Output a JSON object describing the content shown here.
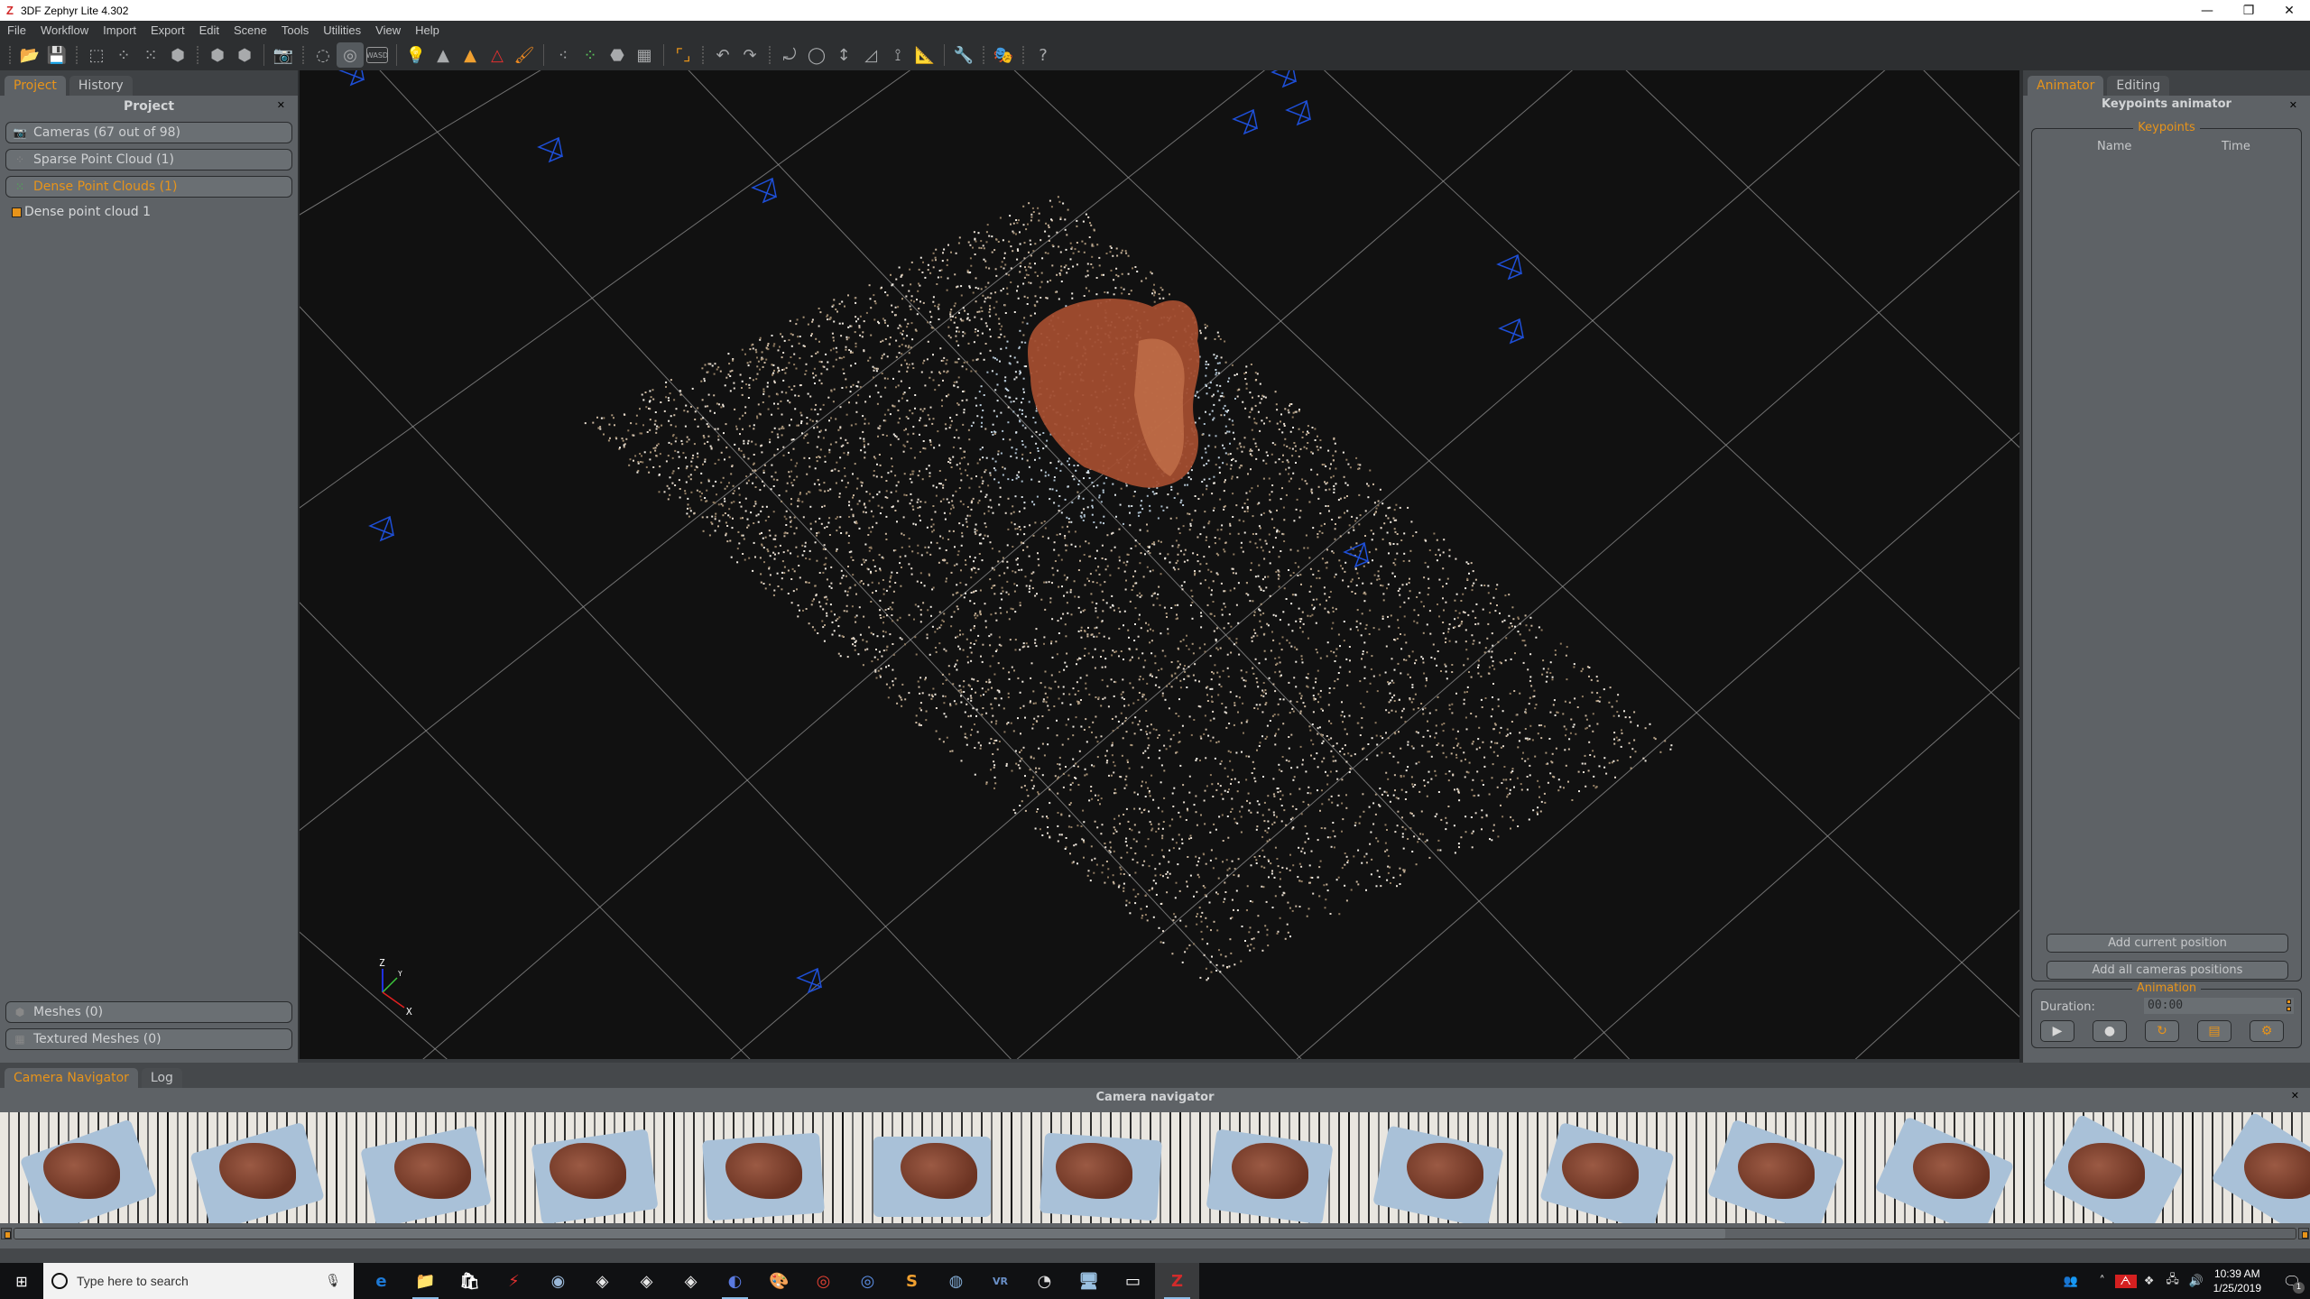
{
  "window": {
    "title": "3DF Zephyr Lite 4.302",
    "app_icon_glyph": "Z",
    "controls": {
      "minimize": "—",
      "restore": "❐",
      "close": "✕"
    }
  },
  "menubar": {
    "items": [
      "File",
      "Workflow",
      "Import",
      "Export",
      "Edit",
      "Scene",
      "Tools",
      "Utilities",
      "View",
      "Help"
    ]
  },
  "toolbar": {
    "buttons": [
      {
        "name": "open-project-icon",
        "glyph": "📂"
      },
      {
        "name": "save-project-icon",
        "glyph": "💾"
      },
      {
        "name": "select-region-icon",
        "glyph": "⬚"
      },
      {
        "name": "sparse-cloud-icon",
        "glyph": "⁘"
      },
      {
        "name": "dense-cloud-icon",
        "glyph": "⁙"
      },
      {
        "name": "mesh-icon",
        "glyph": "⬢"
      },
      {
        "name": "mesh-export-icon",
        "glyph": "⬢"
      },
      {
        "name": "textured-mesh-export-icon",
        "glyph": "⬢"
      },
      {
        "name": "screenshot-camera-icon",
        "glyph": "📷"
      },
      {
        "name": "orbit-mode-icon",
        "glyph": "◌"
      },
      {
        "name": "pivot-orbit-mode-icon",
        "glyph": "◎"
      },
      {
        "name": "wasd-navigation-icon",
        "glyph": "WASD"
      },
      {
        "name": "lighting-bulb-icon",
        "glyph": "💡"
      },
      {
        "name": "render-points-icon",
        "glyph": "▲"
      },
      {
        "name": "render-color-points-icon",
        "glyph": "▲"
      },
      {
        "name": "render-wireframe-icon",
        "glyph": "△"
      },
      {
        "name": "paint-brush-icon",
        "glyph": "🖌"
      },
      {
        "name": "show-sparse-points-icon",
        "glyph": "⁖"
      },
      {
        "name": "show-dense-points-icon",
        "glyph": "⁘"
      },
      {
        "name": "show-mesh-icon",
        "glyph": "⬣"
      },
      {
        "name": "show-textured-mesh-icon",
        "glyph": "▦"
      },
      {
        "name": "bounding-box-icon",
        "glyph": "⌜⌟"
      },
      {
        "name": "undo-icon",
        "glyph": "↶"
      },
      {
        "name": "redo-icon",
        "glyph": "↷"
      },
      {
        "name": "rotate-free-icon",
        "glyph": "⤾"
      },
      {
        "name": "rotate-circle-icon",
        "glyph": "◯"
      },
      {
        "name": "measure-distance-icon",
        "glyph": "↕"
      },
      {
        "name": "measure-angle-icon",
        "glyph": "◿"
      },
      {
        "name": "gizmo-axes-icon",
        "glyph": "⟟"
      },
      {
        "name": "ruler-icon",
        "glyph": "📐"
      },
      {
        "name": "wrench-icon",
        "glyph": "🔧"
      },
      {
        "name": "mask-icon",
        "glyph": "🎭"
      },
      {
        "name": "help-icon",
        "glyph": "?"
      }
    ]
  },
  "left_panel": {
    "tabs": [
      {
        "label": "Project",
        "active": true
      },
      {
        "label": "History",
        "active": false
      }
    ],
    "title": "Project",
    "close_glyph": "✕",
    "groups_top": [
      {
        "label": "Cameras (67 out of 98)",
        "icon": "camera-icon",
        "glyph": "📷",
        "active": false
      },
      {
        "label": "Sparse Point Cloud (1)",
        "icon": "sparse-cloud-icon",
        "glyph": "⁘",
        "active": false
      },
      {
        "label": "Dense Point Clouds (1)",
        "icon": "dense-cloud-icon",
        "glyph": "⁙",
        "active": true
      }
    ],
    "tree_items": [
      {
        "label": "Dense point cloud 1"
      }
    ],
    "groups_bottom": [
      {
        "label": "Meshes (0)",
        "icon": "mesh-icon",
        "glyph": "⬢"
      },
      {
        "label": "Textured Meshes (0)",
        "icon": "textured-mesh-icon",
        "glyph": "▦"
      }
    ]
  },
  "viewport": {
    "axis_labels": {
      "x": "X",
      "y": "Y",
      "z": "Z"
    },
    "colors": {
      "background": "#111111",
      "grid": "#9a9a9a",
      "camera": "#1e4fd8",
      "axis_x": "#e02020",
      "axis_y": "#3cc83c",
      "axis_z": "#2030e0"
    }
  },
  "right_panel": {
    "tabs": [
      {
        "label": "Animator",
        "active": true
      },
      {
        "label": "Editing",
        "active": false
      }
    ],
    "title": "Keypoints animator",
    "close_glyph": "✕",
    "keypoints": {
      "legend": "Keypoints",
      "columns": [
        "Name",
        "Time"
      ],
      "rows": []
    },
    "add_current_label": "Add current position",
    "add_all_label": "Add all cameras positions",
    "animation": {
      "legend": "Animation",
      "duration_label": "Duration:",
      "duration_value": "00:00",
      "buttons": [
        {
          "name": "play-icon",
          "glyph": "▶",
          "color": "#d8d8d8"
        },
        {
          "name": "record-icon",
          "glyph": "●",
          "color": "#d8d8d8"
        },
        {
          "name": "loop-icon",
          "glyph": "↻",
          "color": "#e8941a"
        },
        {
          "name": "film-export-icon",
          "glyph": "▤",
          "color": "#e8941a"
        },
        {
          "name": "settings-gear-icon",
          "glyph": "⚙",
          "color": "#e8941a"
        }
      ]
    }
  },
  "bottom_dock": {
    "tabs": [
      {
        "label": "Camera Navigator",
        "active": true
      },
      {
        "label": "Log",
        "active": false
      }
    ],
    "title": "Camera navigator",
    "close_glyph": "✕",
    "thumbnail_count": 14,
    "scroll_position": 0.75
  },
  "taskbar": {
    "search_placeholder": "Type here to search",
    "apps": [
      {
        "name": "edge-icon",
        "glyph": "e",
        "color": "#1e7ad6",
        "running": false
      },
      {
        "name": "file-explorer-icon",
        "glyph": "📁",
        "color": "#f2c94c",
        "running": true
      },
      {
        "name": "store-icon",
        "glyph": "🛍",
        "color": "#ffffff",
        "running": false
      },
      {
        "name": "app-red-bolt-icon",
        "glyph": "⚡",
        "color": "#e03030",
        "running": false
      },
      {
        "name": "steam-icon",
        "glyph": "◉",
        "color": "#9ab8d8",
        "running": false
      },
      {
        "name": "unity-icon",
        "glyph": "◈",
        "color": "#e8e8e8",
        "running": false
      },
      {
        "name": "unity-icon-2",
        "glyph": "◈",
        "color": "#e8e8e8",
        "running": false
      },
      {
        "name": "unity-icon-3",
        "glyph": "◈",
        "color": "#e8e8e8",
        "running": false
      },
      {
        "name": "cinema4d-icon",
        "glyph": "◐",
        "color": "#5a7ae0",
        "running": true
      },
      {
        "name": "paint-palette-icon",
        "glyph": "🎨",
        "color": "#e8d060",
        "running": false
      },
      {
        "name": "chrome-icon",
        "glyph": "◎",
        "color": "#e34133",
        "running": false
      },
      {
        "name": "chromium-icon",
        "glyph": "◎",
        "color": "#5c8fe6",
        "running": false
      },
      {
        "name": "sublime-text-icon",
        "glyph": "S",
        "color": "#f0a030",
        "running": false
      },
      {
        "name": "steamvr-icon",
        "glyph": "◍",
        "color": "#80a8d0",
        "running": false
      },
      {
        "name": "vr-icon",
        "glyph": "VR",
        "color": "#6a90c8",
        "running": false
      },
      {
        "name": "obs-icon",
        "glyph": "◔",
        "color": "#dddddd",
        "running": false
      },
      {
        "name": "monitor-icon",
        "glyph": "🖥",
        "color": "#9ac0e0",
        "running": false
      },
      {
        "name": "oculus-icon",
        "glyph": "▭",
        "color": "#ffffff",
        "running": false
      },
      {
        "name": "zephyr-icon",
        "glyph": "Z",
        "color": "#d22b2b",
        "running": true,
        "focused": true
      }
    ],
    "tray": [
      {
        "name": "people-icon",
        "glyph": "👥"
      },
      {
        "name": "show-hidden-chevron-icon",
        "glyph": "˄"
      },
      {
        "name": "avira-icon",
        "glyph": "ᗅ"
      },
      {
        "name": "dropbox-icon",
        "glyph": "❖"
      },
      {
        "name": "network-warning-icon",
        "glyph": "🖧"
      },
      {
        "name": "volume-icon",
        "glyph": "🔊"
      }
    ],
    "time": "10:39 AM",
    "date": "1/25/2019",
    "notifications_count": "1"
  }
}
